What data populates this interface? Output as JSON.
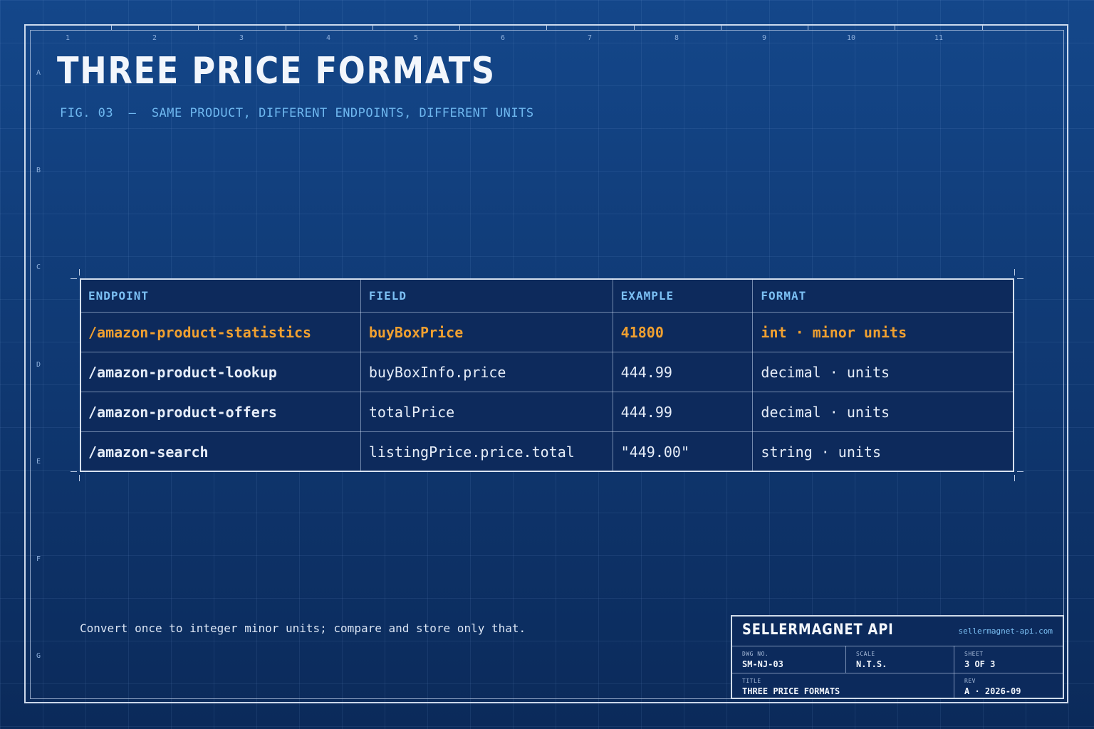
{
  "frame": {
    "zone_numbers": [
      "1",
      "2",
      "3",
      "4",
      "5",
      "6",
      "7",
      "8",
      "9",
      "10",
      "11"
    ],
    "zone_letters": [
      "A",
      "B",
      "C",
      "D",
      "E",
      "F",
      "G"
    ]
  },
  "title": "THREE PRICE FORMATS",
  "subtitle": "FIG. 03  —  SAME PRODUCT, DIFFERENT ENDPOINTS, DIFFERENT UNITS",
  "table": {
    "headers": [
      "ENDPOINT",
      "FIELD",
      "EXAMPLE",
      "FORMAT"
    ],
    "rows": [
      {
        "endpoint": "/amazon-product-statistics",
        "field": "buyBoxPrice",
        "example": "41800",
        "format": "int · minor units",
        "highlight": true
      },
      {
        "endpoint": "/amazon-product-lookup",
        "field": "buyBoxInfo.price",
        "example": "444.99",
        "format": "decimal · units",
        "highlight": false
      },
      {
        "endpoint": "/amazon-product-offers",
        "field": "totalPrice",
        "example": "444.99",
        "format": "decimal · units",
        "highlight": false
      },
      {
        "endpoint": "/amazon-search",
        "field": "listingPrice.price.total",
        "example": "\"449.00\"",
        "format": "string · units",
        "highlight": false
      }
    ]
  },
  "note": "Convert once to integer minor units; compare and store only that.",
  "title_block": {
    "brand": "SELLERMAGNET API",
    "url": "sellermagnet-api.com",
    "dwg_no_label": "DWG NO.",
    "dwg_no": "SM-NJ-03",
    "scale_label": "SCALE",
    "scale": "N.T.S.",
    "sheet_label": "SHEET",
    "sheet": "3 OF 3",
    "title_label": "TITLE",
    "title": "THREE PRICE FORMATS",
    "rev_label": "REV",
    "rev": "A · 2026-09"
  },
  "colors": {
    "background": "#0f3468",
    "accent_orange": "#f0a030",
    "accent_blue": "#7cc0f4"
  }
}
